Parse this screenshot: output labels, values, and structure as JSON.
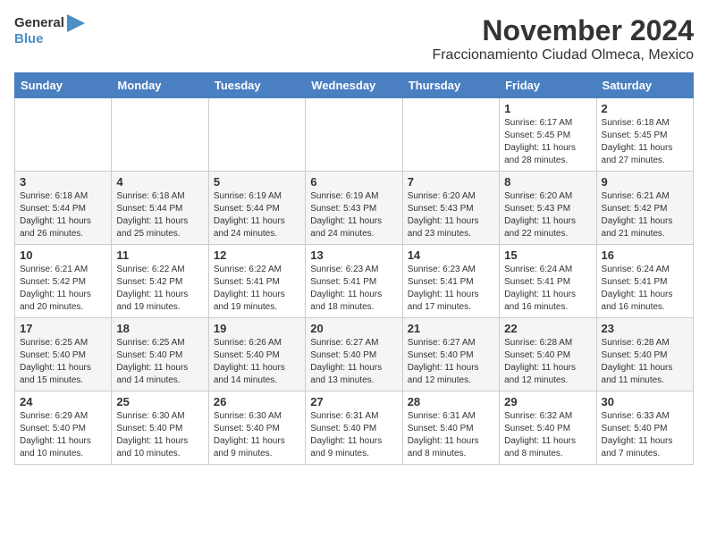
{
  "logo": {
    "general": "General",
    "blue": "Blue"
  },
  "title": "November 2024",
  "location": "Fraccionamiento Ciudad Olmeca, Mexico",
  "weekdays": [
    "Sunday",
    "Monday",
    "Tuesday",
    "Wednesday",
    "Thursday",
    "Friday",
    "Saturday"
  ],
  "weeks": [
    [
      {
        "day": "",
        "info": ""
      },
      {
        "day": "",
        "info": ""
      },
      {
        "day": "",
        "info": ""
      },
      {
        "day": "",
        "info": ""
      },
      {
        "day": "",
        "info": ""
      },
      {
        "day": "1",
        "info": "Sunrise: 6:17 AM\nSunset: 5:45 PM\nDaylight: 11 hours and 28 minutes."
      },
      {
        "day": "2",
        "info": "Sunrise: 6:18 AM\nSunset: 5:45 PM\nDaylight: 11 hours and 27 minutes."
      }
    ],
    [
      {
        "day": "3",
        "info": "Sunrise: 6:18 AM\nSunset: 5:44 PM\nDaylight: 11 hours and 26 minutes."
      },
      {
        "day": "4",
        "info": "Sunrise: 6:18 AM\nSunset: 5:44 PM\nDaylight: 11 hours and 25 minutes."
      },
      {
        "day": "5",
        "info": "Sunrise: 6:19 AM\nSunset: 5:44 PM\nDaylight: 11 hours and 24 minutes."
      },
      {
        "day": "6",
        "info": "Sunrise: 6:19 AM\nSunset: 5:43 PM\nDaylight: 11 hours and 24 minutes."
      },
      {
        "day": "7",
        "info": "Sunrise: 6:20 AM\nSunset: 5:43 PM\nDaylight: 11 hours and 23 minutes."
      },
      {
        "day": "8",
        "info": "Sunrise: 6:20 AM\nSunset: 5:43 PM\nDaylight: 11 hours and 22 minutes."
      },
      {
        "day": "9",
        "info": "Sunrise: 6:21 AM\nSunset: 5:42 PM\nDaylight: 11 hours and 21 minutes."
      }
    ],
    [
      {
        "day": "10",
        "info": "Sunrise: 6:21 AM\nSunset: 5:42 PM\nDaylight: 11 hours and 20 minutes."
      },
      {
        "day": "11",
        "info": "Sunrise: 6:22 AM\nSunset: 5:42 PM\nDaylight: 11 hours and 19 minutes."
      },
      {
        "day": "12",
        "info": "Sunrise: 6:22 AM\nSunset: 5:41 PM\nDaylight: 11 hours and 19 minutes."
      },
      {
        "day": "13",
        "info": "Sunrise: 6:23 AM\nSunset: 5:41 PM\nDaylight: 11 hours and 18 minutes."
      },
      {
        "day": "14",
        "info": "Sunrise: 6:23 AM\nSunset: 5:41 PM\nDaylight: 11 hours and 17 minutes."
      },
      {
        "day": "15",
        "info": "Sunrise: 6:24 AM\nSunset: 5:41 PM\nDaylight: 11 hours and 16 minutes."
      },
      {
        "day": "16",
        "info": "Sunrise: 6:24 AM\nSunset: 5:41 PM\nDaylight: 11 hours and 16 minutes."
      }
    ],
    [
      {
        "day": "17",
        "info": "Sunrise: 6:25 AM\nSunset: 5:40 PM\nDaylight: 11 hours and 15 minutes."
      },
      {
        "day": "18",
        "info": "Sunrise: 6:25 AM\nSunset: 5:40 PM\nDaylight: 11 hours and 14 minutes."
      },
      {
        "day": "19",
        "info": "Sunrise: 6:26 AM\nSunset: 5:40 PM\nDaylight: 11 hours and 14 minutes."
      },
      {
        "day": "20",
        "info": "Sunrise: 6:27 AM\nSunset: 5:40 PM\nDaylight: 11 hours and 13 minutes."
      },
      {
        "day": "21",
        "info": "Sunrise: 6:27 AM\nSunset: 5:40 PM\nDaylight: 11 hours and 12 minutes."
      },
      {
        "day": "22",
        "info": "Sunrise: 6:28 AM\nSunset: 5:40 PM\nDaylight: 11 hours and 12 minutes."
      },
      {
        "day": "23",
        "info": "Sunrise: 6:28 AM\nSunset: 5:40 PM\nDaylight: 11 hours and 11 minutes."
      }
    ],
    [
      {
        "day": "24",
        "info": "Sunrise: 6:29 AM\nSunset: 5:40 PM\nDaylight: 11 hours and 10 minutes."
      },
      {
        "day": "25",
        "info": "Sunrise: 6:30 AM\nSunset: 5:40 PM\nDaylight: 11 hours and 10 minutes."
      },
      {
        "day": "26",
        "info": "Sunrise: 6:30 AM\nSunset: 5:40 PM\nDaylight: 11 hours and 9 minutes."
      },
      {
        "day": "27",
        "info": "Sunrise: 6:31 AM\nSunset: 5:40 PM\nDaylight: 11 hours and 9 minutes."
      },
      {
        "day": "28",
        "info": "Sunrise: 6:31 AM\nSunset: 5:40 PM\nDaylight: 11 hours and 8 minutes."
      },
      {
        "day": "29",
        "info": "Sunrise: 6:32 AM\nSunset: 5:40 PM\nDaylight: 11 hours and 8 minutes."
      },
      {
        "day": "30",
        "info": "Sunrise: 6:33 AM\nSunset: 5:40 PM\nDaylight: 11 hours and 7 minutes."
      }
    ]
  ]
}
